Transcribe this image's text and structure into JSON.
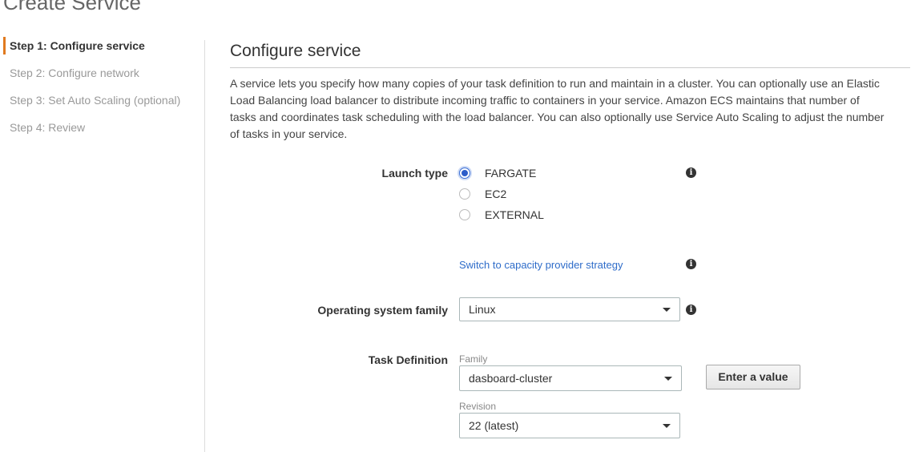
{
  "page": {
    "title": "Create Service"
  },
  "steps": [
    {
      "label": "Step 1: Configure service",
      "active": true
    },
    {
      "label": "Step 2: Configure network",
      "active": false
    },
    {
      "label": "Step 3: Set Auto Scaling (optional)",
      "active": false
    },
    {
      "label": "Step 4: Review",
      "active": false
    }
  ],
  "main": {
    "section_title": "Configure service",
    "description": "A service lets you specify how many copies of your task definition to run and maintain in a cluster. You can optionally use an Elastic Load Balancing load balancer to distribute incoming traffic to containers in your service. Amazon ECS maintains that number of tasks and coordinates task scheduling with the load balancer. You can also optionally use Service Auto Scaling to adjust the number of tasks in your service.",
    "launch_type": {
      "label": "Launch type",
      "options": [
        "FARGATE",
        "EC2",
        "EXTERNAL"
      ],
      "selected": "FARGATE"
    },
    "capacity_link": "Switch to capacity provider strategy",
    "os_family": {
      "label": "Operating system family",
      "value": "Linux"
    },
    "task_definition": {
      "label": "Task Definition",
      "family_label": "Family",
      "family_value": "dasboard-cluster",
      "enter_value_button": "Enter a value",
      "revision_label": "Revision",
      "revision_value": "22 (latest)"
    }
  },
  "icons": {
    "info": "info-icon",
    "dropdown": "chevron-down-icon"
  },
  "colors": {
    "active_step_accent": "#e07a1f",
    "link": "#2e6cc9",
    "radio_selected": "#2c5dc9"
  }
}
